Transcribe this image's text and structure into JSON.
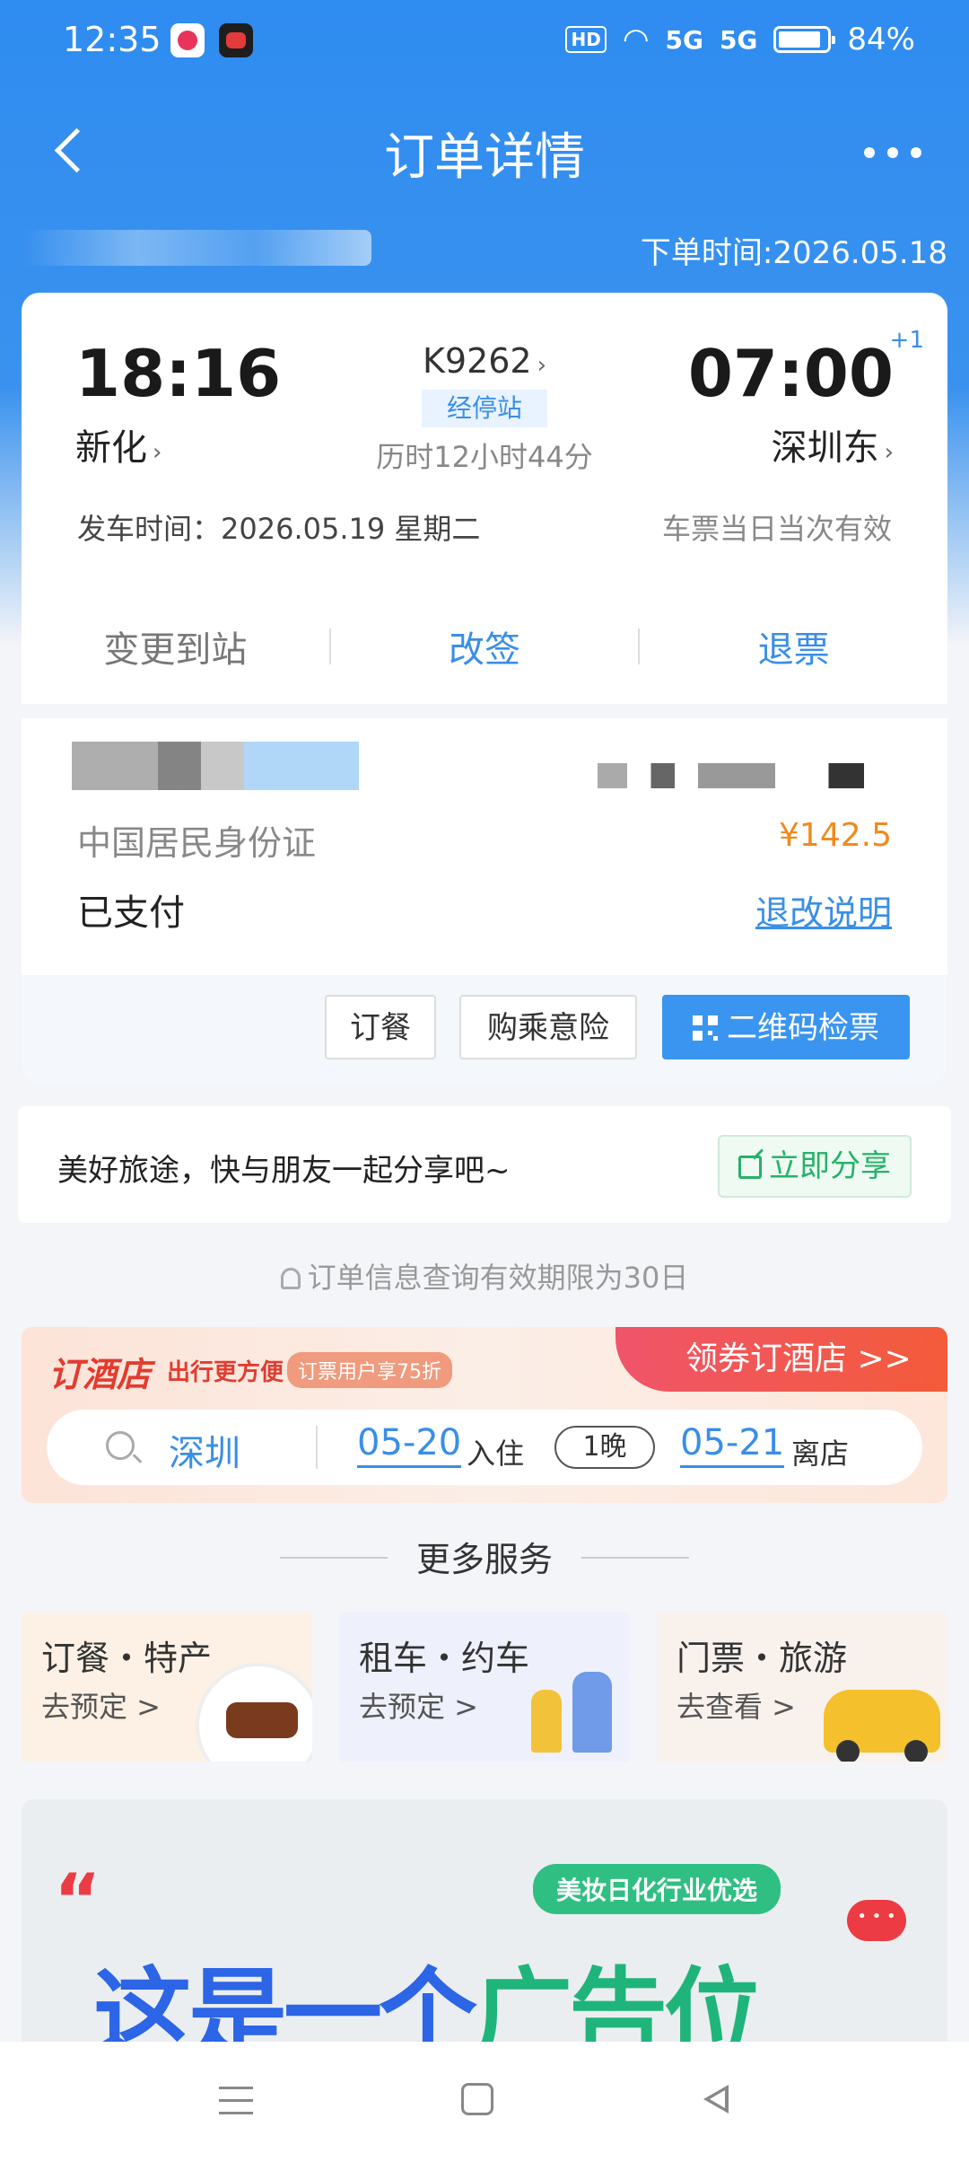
{
  "status_bar": {
    "time": "12:35",
    "network1": "5G",
    "network2": "5G",
    "hd": "HD",
    "battery": "84%"
  },
  "nav": {
    "title": "订单详情"
  },
  "order": {
    "order_time": "下单时间:2026.05.18"
  },
  "trip": {
    "depart_time": "18:16",
    "arrive_time": "07:00",
    "plus_day": "+1",
    "depart_station": "新化",
    "arrive_station": "深圳东",
    "train_no": "K9262",
    "stops_label": "经停站",
    "duration": "历时12小时44分",
    "depart_date": "发车时间：2026.05.19 星期二",
    "validity": "车票当日当次有效"
  },
  "actions": {
    "change_station": "变更到站",
    "reschedule": "改签",
    "refund": "退票"
  },
  "passenger": {
    "id_type": "中国居民身份证",
    "price": "¥142.5",
    "pay_status": "已支付",
    "refund_rules": "退改说明",
    "btn_meal": "订餐",
    "btn_insurance": "购乘意险",
    "btn_qr": "二维码检票"
  },
  "share": {
    "text": "美好旅途，快与朋友一起分享吧~",
    "button": "立即分享"
  },
  "notice": "订单信息查询有效期限为30日",
  "hotel": {
    "title": "订酒店",
    "subtitle": "出行更方便",
    "badge": "订票用户享75折",
    "coupon": "领券订酒店 >>",
    "city": "深圳",
    "checkin_date": "05-20",
    "checkin_label": "入住",
    "nights": "1晚",
    "checkout_date": "05-21",
    "checkout_label": "离店"
  },
  "more_services": {
    "title": "更多服务",
    "items": [
      {
        "title": "订餐・特产",
        "action": "去预定 >"
      },
      {
        "title": "租车・约车",
        "action": "去预定 >"
      },
      {
        "title": "门票・旅游",
        "action": "去查看 >"
      }
    ]
  },
  "ad": {
    "tag": "美妆日化行业优选",
    "text_part1": "这是一个",
    "text_part2": "广告位"
  }
}
